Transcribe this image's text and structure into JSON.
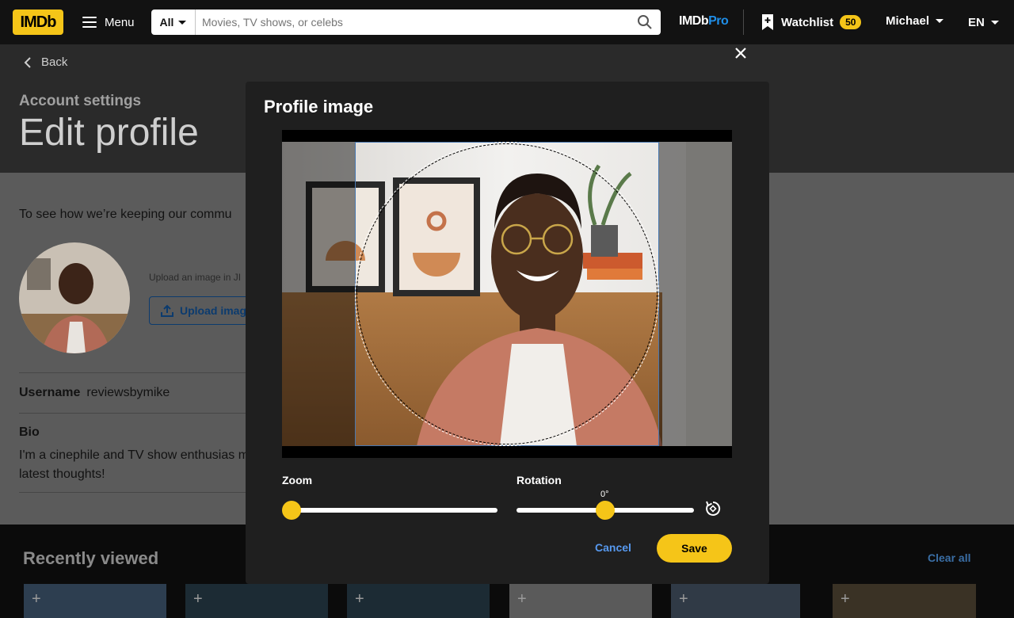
{
  "nav": {
    "logo": "IMDb",
    "menu_label": "Menu",
    "search_category": "All",
    "search_placeholder": "Movies, TV shows, or celebs",
    "pro_part1": "IMDb",
    "pro_part2": "Pro",
    "watchlist_label": "Watchlist",
    "watchlist_count": "50",
    "user_name": "Michael",
    "language": "EN"
  },
  "page": {
    "back_label": "Back",
    "section_label": "Account settings",
    "title": "Edit profile",
    "guidelines_text": "To see how we’re keeping our commu",
    "upload_hint": "Upload an image in JI",
    "upload_button": "Upload imag",
    "username_label": "Username",
    "username_value": "reviewsbymike",
    "bio_label": "Bio",
    "bio_value": "I'm a cinephile and TV show enthusias my latest thoughts!",
    "recently_viewed": "Recently viewed",
    "clear_all": "Clear all"
  },
  "modal": {
    "title": "Profile image",
    "zoom_label": "Zoom",
    "zoom_value": 0,
    "rotation_label": "Rotation",
    "rotation_value": "0°",
    "rotation_fraction": 0.5,
    "cancel_label": "Cancel",
    "save_label": "Save"
  },
  "colors": {
    "brand_yellow": "#f5c518",
    "link_blue": "#5799ef",
    "pro_blue": "#1f8ee8"
  }
}
